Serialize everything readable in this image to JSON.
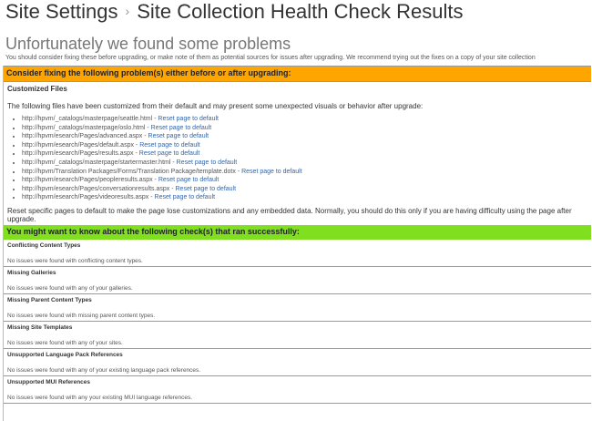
{
  "breadcrumb": {
    "root": "Site Settings",
    "separator": "›",
    "current": "Site Collection Health Check Results"
  },
  "heading": "Unfortunately we found some problems",
  "intro": "You should consider fixing these before upgrading, or make note of them as potential sources for issues after upgrading. We recommend trying out the fixes on a copy of your site collection",
  "problems": {
    "bar": "Consider fixing the following problem(s) either before or after upgrading:",
    "title": "Customized Files",
    "description": "The following files have been customized from their default and may present some unexpected visuals or behavior after upgrade:",
    "link_label": "Reset page to default",
    "files": [
      "http://hpvm/_catalogs/masterpage/seattle.html",
      "http://hpvm/_catalogs/masterpage/oslo.html",
      "http://hpvm/esearch/Pages/advanced.aspx",
      "http://hpvm/esearch/Pages/default.aspx",
      "http://hpvm/esearch/Pages/results.aspx",
      "http://hpvm/_catalogs/masterpage/startermaster.html",
      "http://hpvm/Translation Packages/Forms/Translation Package/template.dotx",
      "http://hpvm/esearch/Pages/peopleresults.aspx",
      "http://hpvm/esearch/Pages/conversationresults.aspx",
      "http://hpvm/esearch/Pages/videoresults.aspx"
    ],
    "footer": "Reset specific pages to default to make the page lose customizations and any embedded data. Normally, you should do this only if you are having difficulty using the page after upgrade."
  },
  "success": {
    "bar": "You might want to know about the following check(s) that ran successfully:",
    "checks": [
      {
        "title": "Conflicting Content Types",
        "text": "No issues were found with conflicting content types."
      },
      {
        "title": "Missing Galleries",
        "text": "No issues were found with any of your galleries."
      },
      {
        "title": "Missing Parent Content Types",
        "text": "No issues were found with missing parent content types."
      },
      {
        "title": "Missing Site Templates",
        "text": "No issues were found with any of your sites."
      },
      {
        "title": "Unsupported Language Pack References",
        "text": "No issues were found with any of your existing language pack references."
      },
      {
        "title": "Unsupported MUI References",
        "text": "No issues were found with any your existing MUI language references."
      }
    ]
  }
}
